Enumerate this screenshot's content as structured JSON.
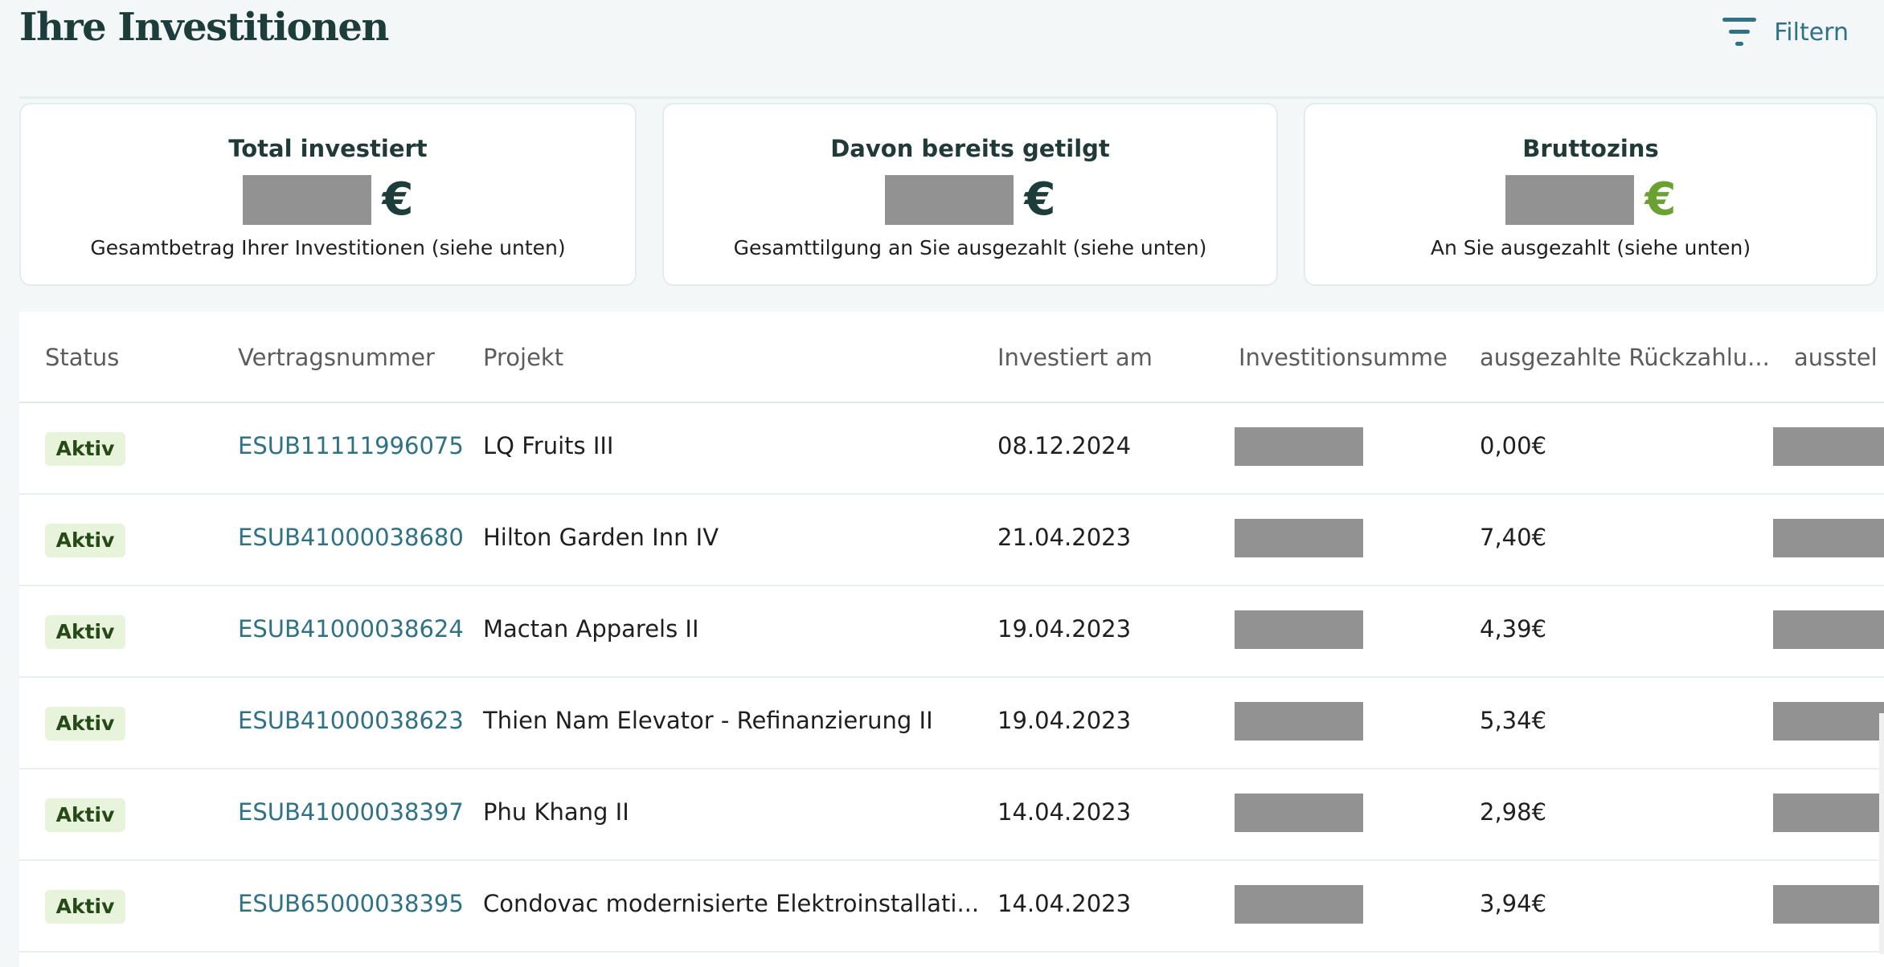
{
  "page": {
    "title": "Ihre Investitionen"
  },
  "filter": {
    "label": "Filtern",
    "icon": "filter-icon"
  },
  "colors": {
    "accent": "#2f7185",
    "title": "#1d3d3a",
    "green_euro": "#6aa231",
    "badge_bg": "#e8f3dc",
    "badge_text": "#264a17"
  },
  "cards": [
    {
      "title": "Total investiert",
      "currency": "€",
      "description": "Gesamtbetrag Ihrer Investitionen (siehe unten)"
    },
    {
      "title": "Davon bereits getilgt",
      "currency": "€",
      "description": "Gesamttilgung an Sie ausgezahlt (siehe unten)"
    },
    {
      "title": "Bruttozins",
      "currency": "€",
      "description": "An Sie ausgezahlt (siehe unten)"
    }
  ],
  "table": {
    "columns": [
      "Status",
      "Vertragsnummer",
      "Projekt",
      "Investiert am",
      "Investitionsumme",
      "ausgezahlte Rückzahlu...",
      "ausstel"
    ],
    "rows": [
      {
        "status": "Aktiv",
        "contract": "ESUB11111996075",
        "project": "LQ Fruits III",
        "date": "08.12.2024",
        "repaid": "0,00€"
      },
      {
        "status": "Aktiv",
        "contract": "ESUB41000038680",
        "project": "Hilton Garden Inn IV",
        "date": "21.04.2023",
        "repaid": "7,40€"
      },
      {
        "status": "Aktiv",
        "contract": "ESUB41000038624",
        "project": "Mactan Apparels II",
        "date": "19.04.2023",
        "repaid": "4,39€"
      },
      {
        "status": "Aktiv",
        "contract": "ESUB41000038623",
        "project": "Thien Nam Elevator - Refinanzierung II",
        "date": "19.04.2023",
        "repaid": "5,34€"
      },
      {
        "status": "Aktiv",
        "contract": "ESUB41000038397",
        "project": "Phu Khang II",
        "date": "14.04.2023",
        "repaid": "2,98€"
      },
      {
        "status": "Aktiv",
        "contract": "ESUB65000038395",
        "project": "Condovac modernisierte Elektroinstallati...",
        "date": "14.04.2023",
        "repaid": "3,94€"
      }
    ]
  }
}
